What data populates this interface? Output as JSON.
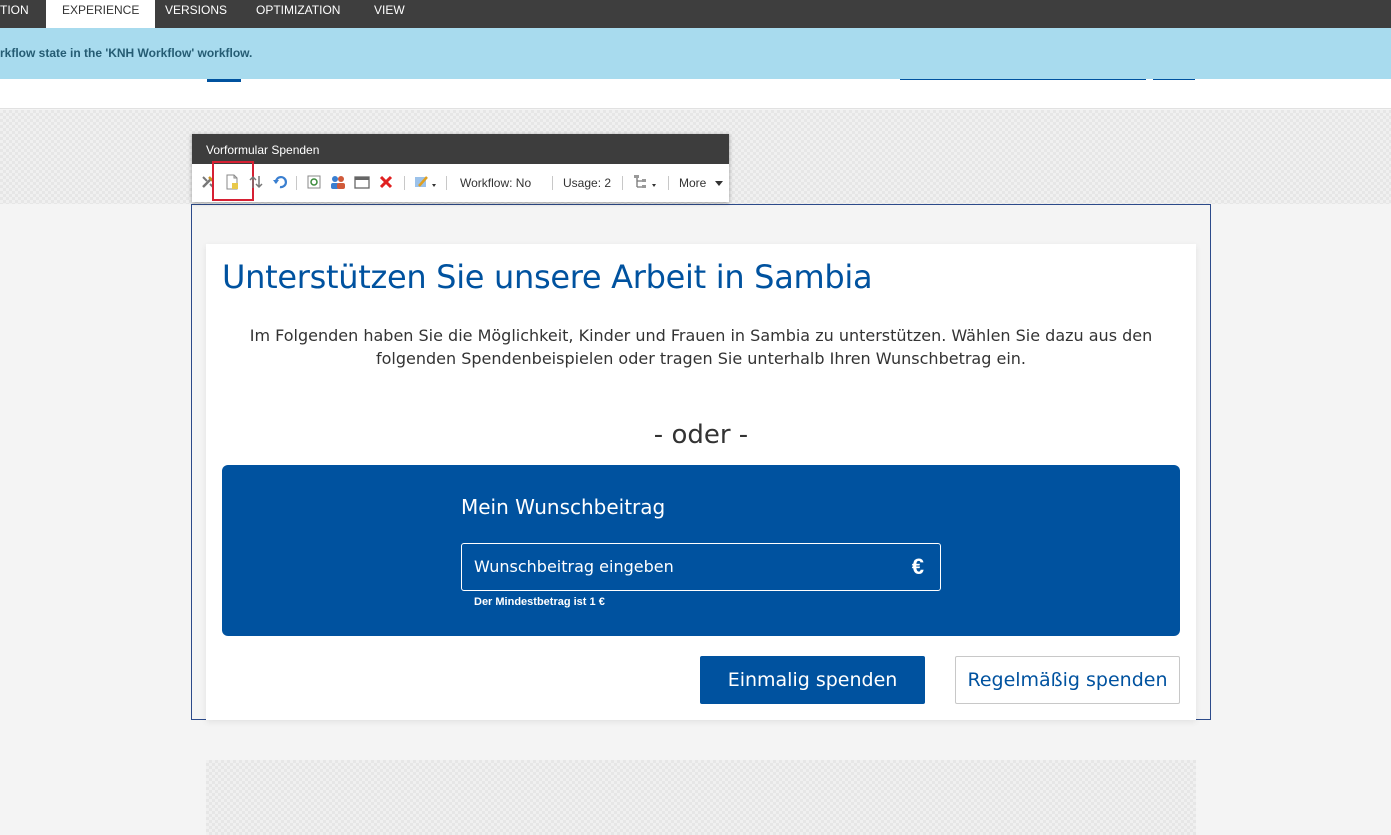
{
  "ribbon": {
    "tabs": [
      {
        "label": "TION"
      },
      {
        "label": "EXPERIENCE"
      },
      {
        "label": "VERSIONS"
      },
      {
        "label": "OPTIMIZATION"
      },
      {
        "label": "VIEW"
      }
    ]
  },
  "notice": {
    "text": "rkflow state in the 'KNH Workflow' workflow."
  },
  "chrome": {
    "title": "Vorformular Spenden",
    "workflow_label": "Workflow: No",
    "usage_label": "Usage: 2",
    "more_label": "More"
  },
  "content": {
    "title": "Unterstützen Sie unsere Arbeit in Sambia",
    "intro": "Im Folgenden haben Sie die Möglichkeit, Kinder und Frauen in Sambia zu unterstützen. Wählen Sie dazu aus den folgenden Spendenbeispielen oder tragen Sie unterhalb Ihren Wunschbetrag ein.",
    "separator": "- oder -",
    "amount_box": {
      "title": "Mein Wunschbeitrag",
      "placeholder": "Wunschbeitrag eingeben",
      "currency": "€",
      "hint": "Der Mindestbetrag ist 1 €"
    },
    "buttons": {
      "once": "Einmalig spenden",
      "recurring": "Regelmäßig spenden"
    }
  },
  "colors": {
    "brand_blue": "#00529f",
    "notice_bg": "#a8dbee",
    "ribbon_bg": "#3e3e3e",
    "highlight_red": "#d62033"
  }
}
